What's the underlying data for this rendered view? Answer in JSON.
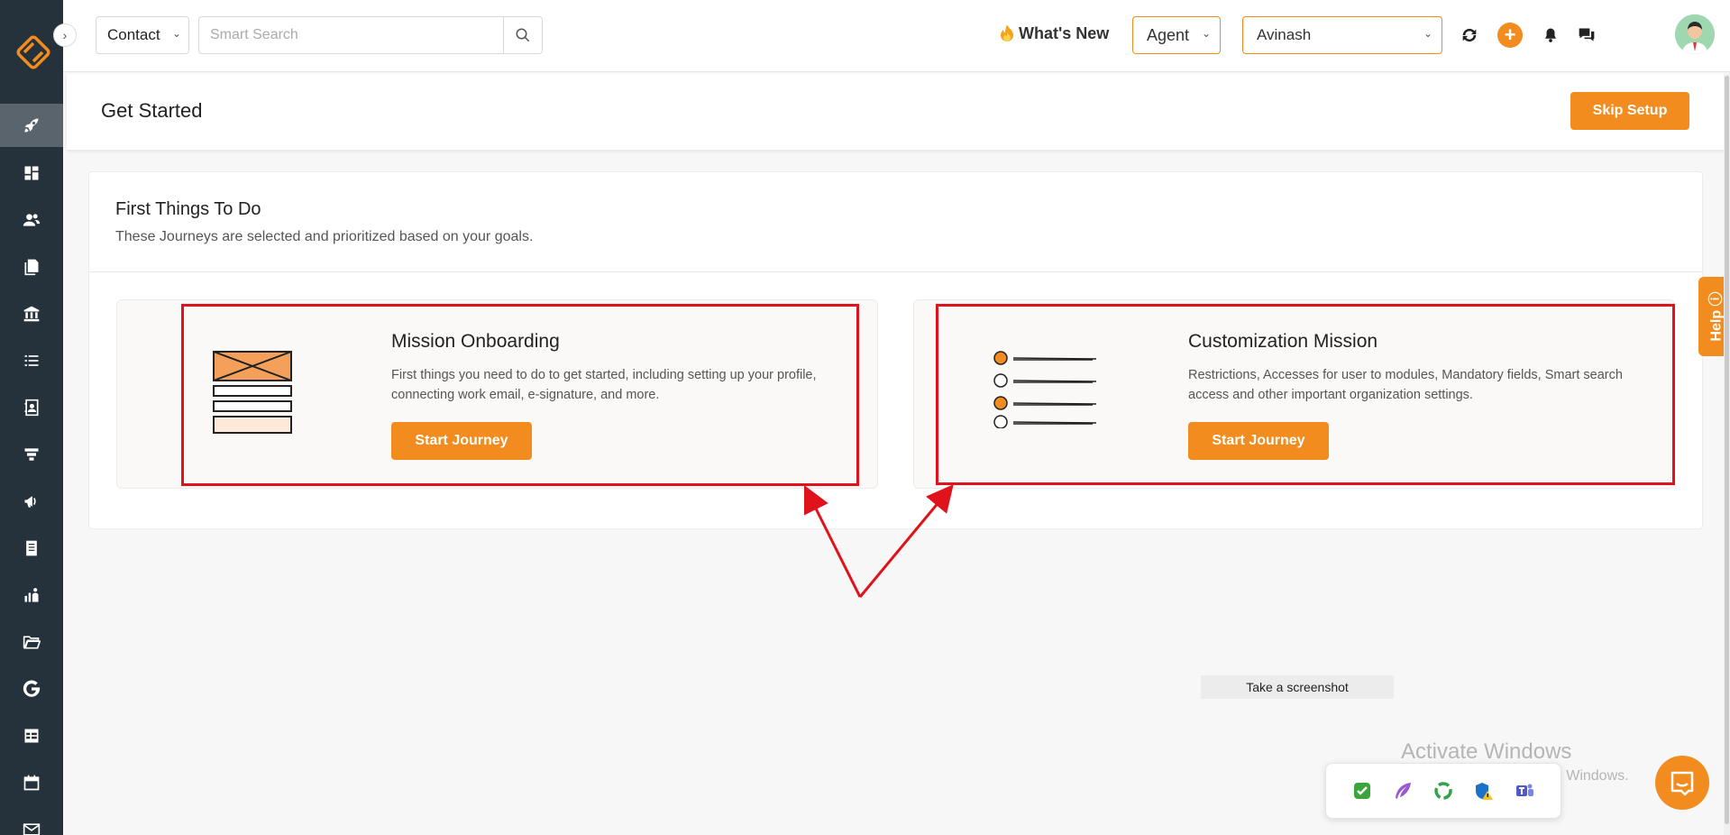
{
  "colors": {
    "accent": "#f28c1e",
    "sidebar": "#25313b",
    "annotation": "#e0121b"
  },
  "topbar": {
    "module_select": "Contact",
    "search_placeholder": "Smart Search",
    "whats_new": "What's New",
    "role_select": "Agent",
    "user_select": "Avinash"
  },
  "sidebar": {
    "items": [
      "rocket-icon",
      "dashboard-icon",
      "contacts-icon",
      "documents-icon",
      "bank-icon",
      "list-icon",
      "address-book-icon",
      "funnel-icon",
      "megaphone-icon",
      "notes-icon",
      "reports-icon",
      "folder-icon",
      "google-icon",
      "table-icon",
      "calendar-icon",
      "mail-icon"
    ]
  },
  "page": {
    "title": "Get Started",
    "skip_label": "Skip Setup"
  },
  "section": {
    "title": "First Things To Do",
    "subtitle": "These Journeys are selected and prioritized based on your goals."
  },
  "journeys": [
    {
      "title": "Mission Onboarding",
      "description": "First things you need to do to get started, including setting up your profile, connecting work email, e-signature, and more.",
      "button": "Start Journey"
    },
    {
      "title": "Customization Mission",
      "description": "Restrictions, Accesses for user to modules, Mandatory fields, Smart search access and other important organization settings.",
      "button": "Start Journey"
    }
  ],
  "help_label": "Help",
  "tooltip": "Take a screenshot",
  "watermark": {
    "line1": "Activate Windows",
    "line2": "Go to Settings to activate Windows."
  }
}
